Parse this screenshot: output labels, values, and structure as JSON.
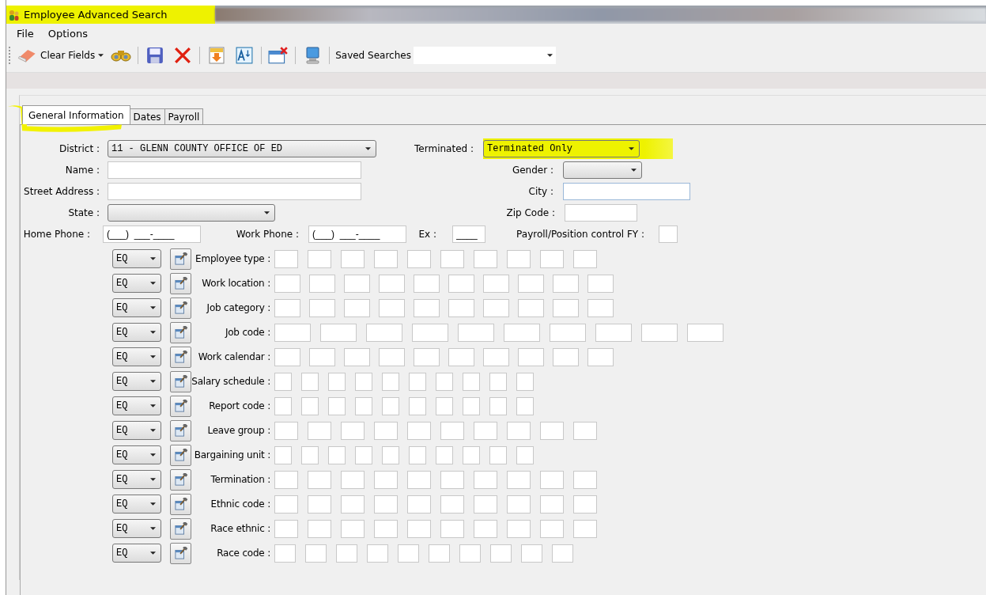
{
  "window": {
    "title": "Employee Advanced Search",
    "highlighted": true
  },
  "menu": [
    {
      "label": "File"
    },
    {
      "label": "Options"
    }
  ],
  "toolbar": {
    "clear_label": "Clear Fields",
    "saved_searches_label": "Saved Searches"
  },
  "tabs": [
    {
      "label": "General Information",
      "selected": true,
      "highlighted": true
    },
    {
      "label": "Dates",
      "selected": false,
      "highlighted": false
    },
    {
      "label": "Payroll",
      "selected": false,
      "highlighted": false
    }
  ],
  "form": {
    "district": {
      "label": "District :",
      "value": "11 - GLENN COUNTY OFFICE OF ED"
    },
    "terminated": {
      "label": "Terminated :",
      "value": "Terminated Only",
      "highlighted": true
    },
    "name": {
      "label": "Name :"
    },
    "gender": {
      "label": "Gender :"
    },
    "street": {
      "label": "Street Address :"
    },
    "city": {
      "label": "City :"
    },
    "state": {
      "label": "State :"
    },
    "zip": {
      "label": "Zip Code :"
    },
    "home_phone": {
      "label": "Home Phone :",
      "value": "(___)  ___-____"
    },
    "work_phone": {
      "label": "Work Phone :",
      "value": "(___)  ___-____"
    },
    "ex": {
      "label": "Ex :",
      "value": "____"
    },
    "fy": {
      "label": "Payroll/Position control FY :"
    }
  },
  "criteria": [
    {
      "label": "Employee type :",
      "operator": "EQ",
      "kind": "standard"
    },
    {
      "label": "Work location :",
      "operator": "EQ",
      "kind": "medium"
    },
    {
      "label": "Job category :",
      "operator": "EQ",
      "kind": "medium"
    },
    {
      "label": "Job code :",
      "operator": "EQ",
      "kind": "wide"
    },
    {
      "label": "Work calendar :",
      "operator": "EQ",
      "kind": "medium"
    },
    {
      "label": "Salary schedule :",
      "operator": "EQ",
      "kind": "narrow"
    },
    {
      "label": "Report code :",
      "operator": "EQ",
      "kind": "narrow"
    },
    {
      "label": "Leave group :",
      "operator": "EQ",
      "kind": "standard"
    },
    {
      "label": "Bargaining unit :",
      "operator": "EQ",
      "kind": "narrow"
    },
    {
      "label": "Termination :",
      "operator": "EQ",
      "kind": "standard"
    },
    {
      "label": "Ethnic code :",
      "operator": "EQ",
      "kind": "standard"
    },
    {
      "label": "Race ethnic :",
      "operator": "EQ",
      "kind": "standard"
    },
    {
      "label": "Race code :",
      "operator": "EQ",
      "kind": "compact"
    }
  ]
}
